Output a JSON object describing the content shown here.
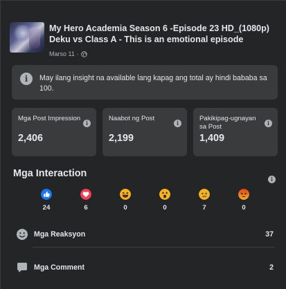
{
  "post": {
    "title": "My Hero Academia Season 6 -Episode 23 HD_(1080p) Deku vs Class A - This is an emotional episode",
    "date": "Marso 11",
    "separator": "·"
  },
  "info_banner": {
    "text": "May ilang insight na available lang kapag ang total ay hindi bababa sa 100."
  },
  "stats": [
    {
      "label": "Mga Post Impression",
      "value": "2,406"
    },
    {
      "label": "Naabot ng Post",
      "value": "2,199"
    },
    {
      "label": "Pakikipag-ugnayan sa Post",
      "value": "1,409"
    }
  ],
  "interactions": {
    "title": "Mga Interaction",
    "reactions": [
      {
        "icon": "like-icon",
        "color": "#1877f2",
        "count": "24"
      },
      {
        "icon": "love-icon",
        "color": "#f33e58",
        "count": "6"
      },
      {
        "icon": "haha-icon",
        "color": "#f7b125",
        "count": "0"
      },
      {
        "icon": "wow-icon",
        "color": "#f7b125",
        "count": "0"
      },
      {
        "icon": "sad-icon",
        "color": "#f7b125",
        "count": "7"
      },
      {
        "icon": "angry-icon",
        "color": "#e9710f",
        "count": "0"
      }
    ],
    "rows": [
      {
        "icon": "smiley-icon",
        "label": "Mga Reaksyon",
        "value": "37"
      },
      {
        "icon": "comment-icon",
        "label": "Mga Comment",
        "value": "2"
      }
    ]
  }
}
